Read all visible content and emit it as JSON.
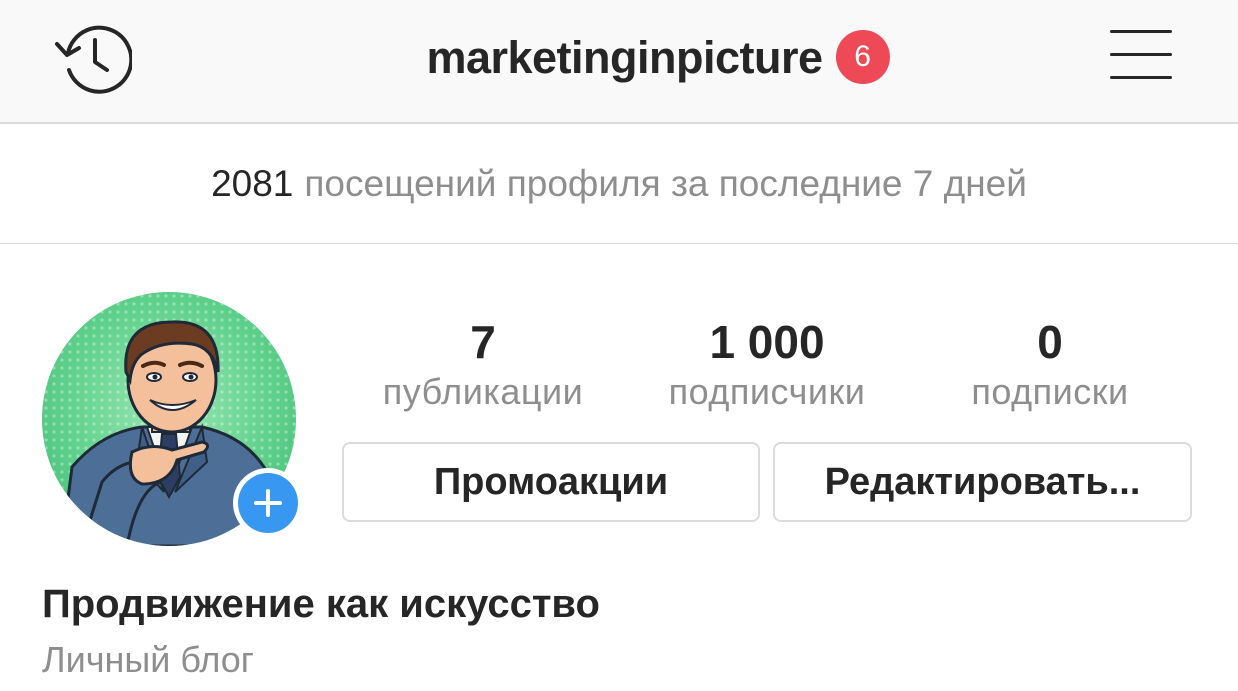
{
  "header": {
    "username": "marketinginpicture",
    "notification_count": "6",
    "history_icon": "history-clock-icon",
    "menu_icon": "hamburger-menu-icon"
  },
  "insights": {
    "visits_count": "2081",
    "visits_label": "посещений профиля за последние 7 дней"
  },
  "stats": {
    "posts": {
      "value": "7",
      "label": "публикации"
    },
    "followers": {
      "value": "1 000",
      "label": "подписчики"
    },
    "following": {
      "value": "0",
      "label": "подписки"
    }
  },
  "actions": {
    "promotions_label": "Промоакции",
    "edit_label": "Редактировать..."
  },
  "bio": {
    "name": "Продвижение как искусство",
    "category": "Личный блог"
  },
  "colors": {
    "badge": "#ed4956",
    "add_story": "#3897f0",
    "secondary_text": "#8e8e8e",
    "avatar_background": "#5fd18c"
  }
}
